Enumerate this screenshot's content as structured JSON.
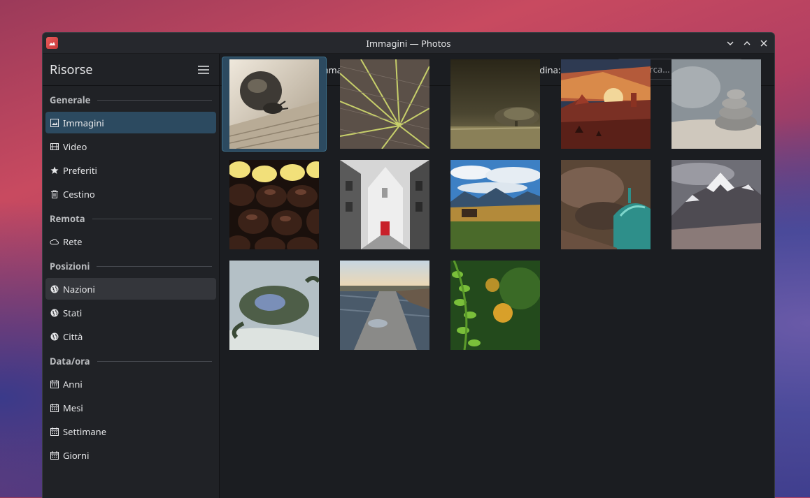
{
  "window": {
    "title": "Immagini — Photos"
  },
  "sidebar": {
    "title": "Risorse",
    "sections": [
      {
        "label": "Generale",
        "items": [
          {
            "label": "Immagini",
            "icon": "image-icon"
          },
          {
            "label": "Video",
            "icon": "film-icon"
          },
          {
            "label": "Preferiti",
            "icon": "star-icon"
          },
          {
            "label": "Cestino",
            "icon": "trash-icon"
          }
        ]
      },
      {
        "label": "Remota",
        "items": [
          {
            "label": "Rete",
            "icon": "cloud-icon"
          }
        ]
      },
      {
        "label": "Posizioni",
        "items": [
          {
            "label": "Nazioni",
            "icon": "globe-icon"
          },
          {
            "label": "Stati",
            "icon": "globe-icon"
          },
          {
            "label": "Città",
            "icon": "globe-icon"
          }
        ]
      },
      {
        "label": "Data/ora",
        "items": [
          {
            "label": "Anni",
            "icon": "calendar-icon"
          },
          {
            "label": "Mesi",
            "icon": "calendar-icon"
          },
          {
            "label": "Settimane",
            "icon": "calendar-icon"
          },
          {
            "label": "Giorni",
            "icon": "calendar-icon"
          }
        ]
      }
    ]
  },
  "toolbar": {
    "breadcrumb": "Immagini",
    "sort_label": "Ordina: Nome",
    "search_placeholder": "Cerca..."
  },
  "thumbnails": [
    {
      "subject": "snail on wood"
    },
    {
      "subject": "leaf veins"
    },
    {
      "subject": "field with tree"
    },
    {
      "subject": "desert sunset illustration"
    },
    {
      "subject": "stacked stones"
    },
    {
      "subject": "chocolates"
    },
    {
      "subject": "church street"
    },
    {
      "subject": "mountain meadow"
    },
    {
      "subject": "cathedral dome"
    },
    {
      "subject": "snowy mountains"
    },
    {
      "subject": "underwater creature"
    },
    {
      "subject": "pier by lake"
    },
    {
      "subject": "green plant bokeh"
    }
  ]
}
